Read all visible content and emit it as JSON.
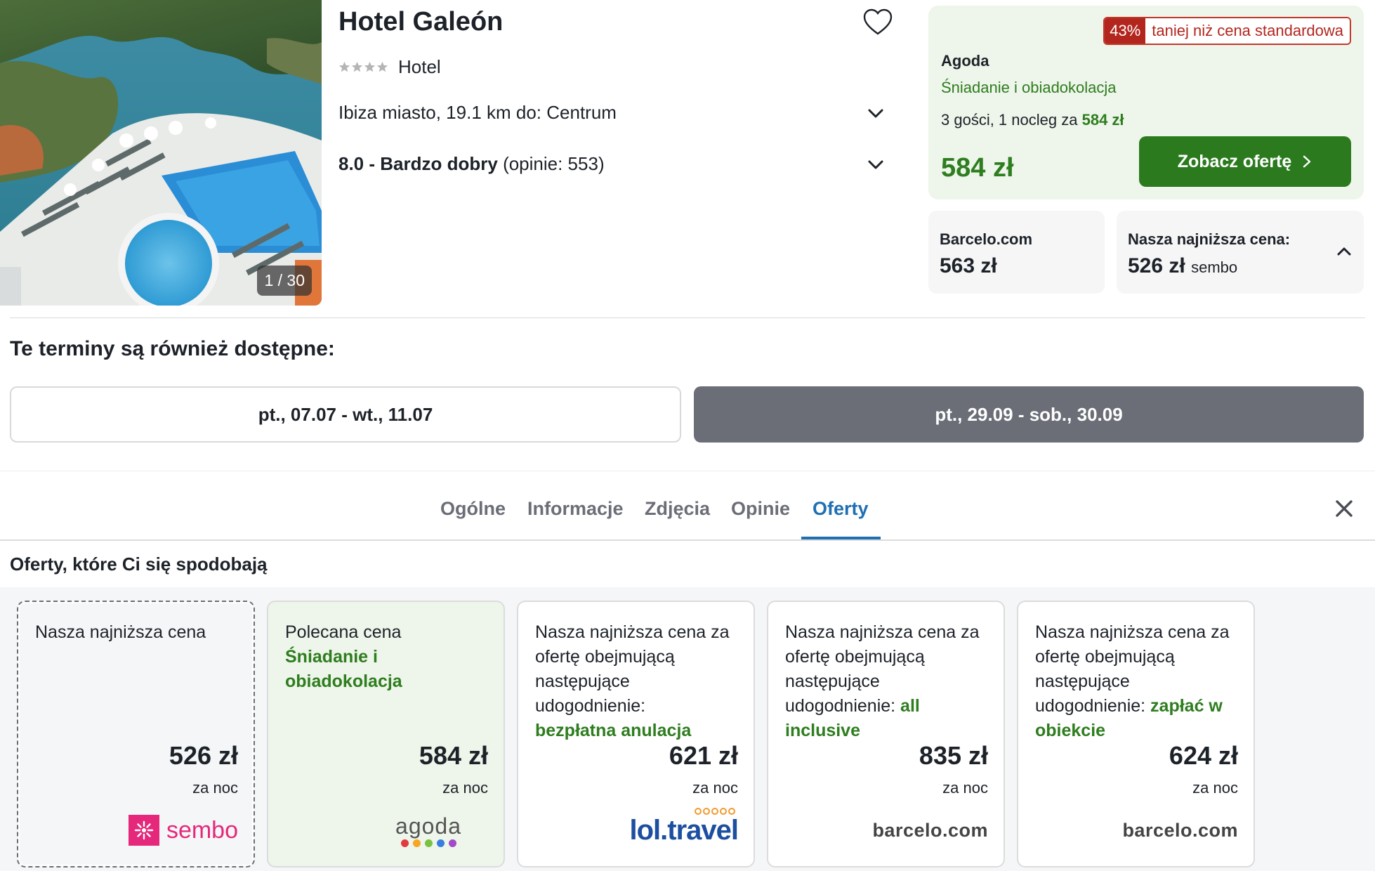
{
  "hotel": {
    "name": "Hotel Galeón",
    "stars": 4,
    "type": "Hotel",
    "location": "Ibiza miasto, 19.1 km do: Centrum",
    "rating_score": "8.0 - Bardzo dobry",
    "rating_count": "(opinie: 553)",
    "photo_counter": "1 / 30"
  },
  "best_offer": {
    "discount_pct": "43%",
    "discount_text": "taniej niż cena standardowa",
    "provider": "Agoda",
    "board": "Śniadanie i obiadokolacja",
    "guests_prefix": "3 gości, 1 nocleg za",
    "guests_price": "584 zł",
    "price": "584 zł",
    "cta_label": "Zobacz ofertę"
  },
  "alt_prices": {
    "barcelo_label": "Barcelo.com",
    "barcelo_price": "563 zł",
    "lowest_label": "Nasza najniższa cena:",
    "lowest_price": "526 zł",
    "lowest_provider": "sembo"
  },
  "dates": {
    "title": "Te terminy są również dostępne:",
    "options": [
      "pt., 07.07 - wt., 11.07",
      "pt., 29.09 - sob., 30.09"
    ]
  },
  "tabs": [
    {
      "label": "Ogólne"
    },
    {
      "label": "Informacje"
    },
    {
      "label": "Zdjęcia"
    },
    {
      "label": "Opinie"
    },
    {
      "label": "Oferty",
      "active": true
    }
  ],
  "offers": {
    "title": "Oferty, które Ci się spodobają",
    "per_night": "za noc",
    "cards": [
      {
        "desc": "Nasza najniższa cena",
        "highlight": "",
        "price": "526 zł",
        "provider": "sembo"
      },
      {
        "desc": "Polecana cena",
        "highlight": "Śniadanie i obiadokolacja",
        "price": "584 zł",
        "provider": "agoda"
      },
      {
        "desc": "Nasza najniższa cena za ofertę obejmującą następujące udogodnienie:",
        "highlight": "bezpłatna anulacja",
        "price": "621 zł",
        "provider": "lol.travel"
      },
      {
        "desc": "Nasza najniższa cena za ofertę obejmującą następujące udogodnienie:",
        "highlight": "all inclusive",
        "price": "835 zł",
        "provider": "barcelo.com"
      },
      {
        "desc": "Nasza najniższa cena za ofertę obejmującą następujące udogodnienie:",
        "highlight": "zapłać w obiekcie",
        "price": "624 zł",
        "provider": "barcelo.com"
      }
    ]
  },
  "colors": {
    "green_accent": "#2e7d1f",
    "cta_green": "#2b7a1e",
    "active_tab": "#1f6fb2",
    "discount_red": "#b3261e",
    "sembo_pink": "#e5287b",
    "lol_blue": "#1d4fa0"
  },
  "icons": [
    "heart-icon",
    "star-icon",
    "chevron-down-icon",
    "chevron-right-icon",
    "chevron-up-icon",
    "close-icon",
    "sembo-logo",
    "agoda-logo",
    "lol-travel-logo",
    "barcelo-logo"
  ]
}
